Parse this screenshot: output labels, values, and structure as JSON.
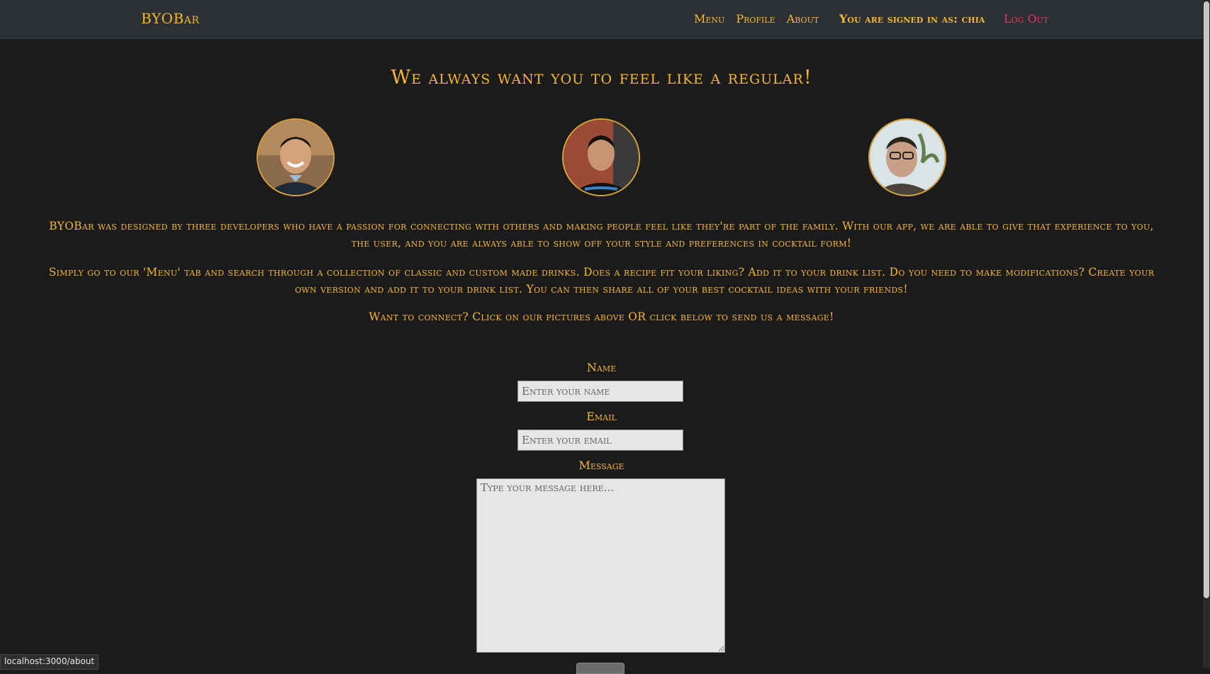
{
  "nav": {
    "brand": "BYOBar",
    "links": [
      "Menu",
      "Profile",
      "About"
    ],
    "signed_in_text": "You are signed in as: chia",
    "logout": "Log Out"
  },
  "about": {
    "title": "We always want you to feel like a regular!",
    "paragraphs": [
      "BYOBar was designed by three developers who have a passion for connecting with others and making people feel like they're part of the family. With our app, we are able to give that experience to you, the user, and you are always able to show off your style and preferences in cocktail form!",
      "Simply go to our 'Menu' tab and search through a collection of classic and custom made drinks. Does a recipe fit your liking? Add it to your drink list. Do you need to make modifications? Create your own version and add it to your drink list. You can then share all of your best cocktail ideas with your friends!",
      "Want to connect? Click on our pictures above OR click below to send us a message!"
    ]
  },
  "form": {
    "name_label": "Name",
    "name_placeholder": "Enter your name",
    "email_label": "Email",
    "email_placeholder": "Enter your email",
    "message_label": "Message",
    "message_placeholder": "Type your message here..."
  },
  "status_bar": {
    "url": "localhost:3000/about"
  },
  "colors": {
    "background": "#1b1b1b",
    "navbar": "#2c2f33",
    "accent_gold": "#f5b731",
    "logout_red": "#e0395a"
  },
  "icons": [
    "developer-avatar-1",
    "developer-avatar-2",
    "developer-avatar-3"
  ]
}
